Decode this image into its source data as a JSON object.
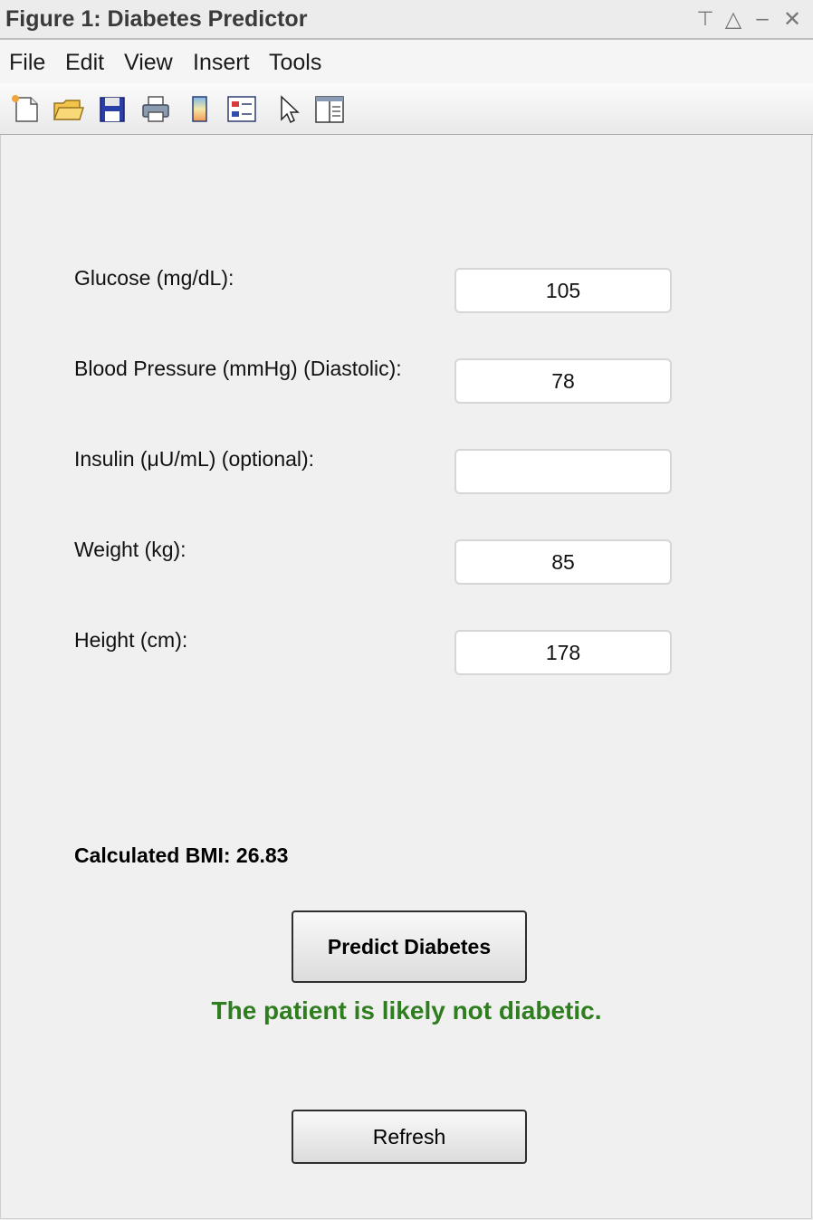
{
  "window": {
    "title": "Figure 1: Diabetes Predictor",
    "controls": {
      "pin": "⊤",
      "maximize": "△",
      "minimize": "–",
      "close": "✕"
    }
  },
  "menu": [
    "File",
    "Edit",
    "View",
    "Insert",
    "Tools"
  ],
  "toolbar": {
    "tools": [
      "new-figure-icon",
      "open-folder-icon",
      "save-icon",
      "print-icon",
      "colorbar-icon",
      "legend-icon",
      "pointer-arrow-icon",
      "property-editor-icon"
    ]
  },
  "form": {
    "glucose": {
      "label": "Glucose (mg/dL):",
      "value": "105"
    },
    "blood_pressure": {
      "label": "Blood Pressure (mmHg) (Diastolic):",
      "value": "78"
    },
    "insulin": {
      "label": "Insulin (μU/mL) (optional):",
      "value": ""
    },
    "weight": {
      "label": "Weight (kg):",
      "value": "85"
    },
    "height": {
      "label": "Height (cm):",
      "value": "178"
    }
  },
  "bmi_text": "Calculated BMI: 26.83",
  "predict_button": "Predict Diabetes",
  "result": {
    "text": "The patient is likely not diabetic.",
    "color": "#2e7d1e"
  },
  "refresh_button": "Refresh"
}
